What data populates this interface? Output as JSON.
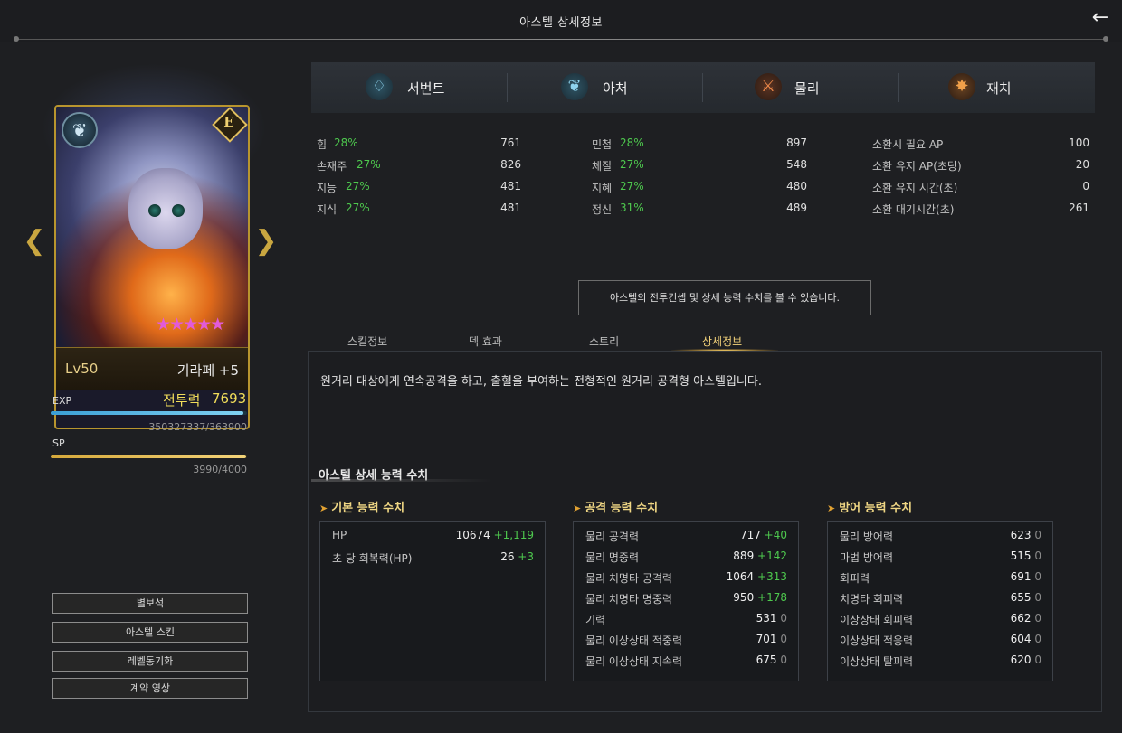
{
  "header": {
    "title": "아스텔 상세정보"
  },
  "card": {
    "level": "Lv50",
    "name": "기라페 +5",
    "grade": "E",
    "stars": "★★★★★"
  },
  "progress": {
    "exp_label": "EXP",
    "power_label": "전투력",
    "power_value": "7693",
    "exp_text": "350327337/363900",
    "exp_fraction": 0.98,
    "sp_label": "SP",
    "sp_text": "3990/4000",
    "sp_fraction": 0.9975
  },
  "side_buttons": [
    "별보석",
    "아스텔 스킨",
    "레벨동기화",
    "계약 영상"
  ],
  "attributes": [
    "서번트",
    "아처",
    "물리",
    "재치"
  ],
  "stats": {
    "col1": [
      {
        "name": "힘",
        "pct": "28%",
        "value": "761"
      },
      {
        "name": "손재주",
        "pct": "27%",
        "value": "826"
      },
      {
        "name": "지능",
        "pct": "27%",
        "value": "481"
      },
      {
        "name": "지식",
        "pct": "27%",
        "value": "481"
      }
    ],
    "col2": [
      {
        "name": "민첩",
        "pct": "28%",
        "value": "897"
      },
      {
        "name": "체질",
        "pct": "27%",
        "value": "548"
      },
      {
        "name": "지혜",
        "pct": "27%",
        "value": "480"
      },
      {
        "name": "정신",
        "pct": "31%",
        "value": "489"
      }
    ],
    "col3": [
      {
        "name": "소환시 필요 AP",
        "value": "100"
      },
      {
        "name": "소환 유지 AP(초당)",
        "value": "20"
      },
      {
        "name": "소환 유지 시간(초)",
        "value": "0"
      },
      {
        "name": "소환 대기시간(초)",
        "value": "261"
      }
    ]
  },
  "info_box": "아스텔의 전투컨셉 및 상세 능력 수치를 볼 수 있습니다.",
  "tabs": [
    "스킬정보",
    "덱 효과",
    "스토리",
    "상세정보"
  ],
  "active_tab": "상세정보",
  "description": "원거리 대상에게 연속공격을 하고, 출혈을 부여하는 전형적인 원거리 공격형 아스텔입니다.",
  "detail": {
    "title": "아스텔 상세 능력 수치",
    "basic": {
      "title": "기본 능력 수치",
      "rows": [
        {
          "name": "HP",
          "base": "10674",
          "bonus": "+1,119"
        },
        {
          "name": "초 당 회복력(HP)",
          "base": "26",
          "bonus": "+3"
        }
      ]
    },
    "attack": {
      "title": "공격 능력 수치",
      "rows": [
        {
          "name": "물리 공격력",
          "base": "717",
          "bonus": "+40"
        },
        {
          "name": "물리 명중력",
          "base": "889",
          "bonus": "+142"
        },
        {
          "name": "물리 치명타 공격력",
          "base": "1064",
          "bonus": "+313"
        },
        {
          "name": "물리 치명타 명중력",
          "base": "950",
          "bonus": "+178"
        },
        {
          "name": "기력",
          "base": "531",
          "bonus": "0"
        },
        {
          "name": "물리 이상상태 적중력",
          "base": "701",
          "bonus": "0"
        },
        {
          "name": "물리 이상상태 지속력",
          "base": "675",
          "bonus": "0"
        }
      ]
    },
    "defense": {
      "title": "방어 능력 수치",
      "rows": [
        {
          "name": "물리 방어력",
          "base": "623",
          "bonus": "0"
        },
        {
          "name": "마법 방어력",
          "base": "515",
          "bonus": "0"
        },
        {
          "name": "회피력",
          "base": "691",
          "bonus": "0"
        },
        {
          "name": "치명타 회피력",
          "base": "655",
          "bonus": "0"
        },
        {
          "name": "이상상태 회피력",
          "base": "662",
          "bonus": "0"
        },
        {
          "name": "이상상태 적응력",
          "base": "604",
          "bonus": "0"
        },
        {
          "name": "이상상태 탈피력",
          "base": "620",
          "bonus": "0"
        }
      ]
    }
  },
  "colors": {
    "gold": "#f0d784",
    "green": "#4ec94e",
    "exp_blue": "#3b9fd6",
    "sp_gold": "#d6a93b"
  }
}
